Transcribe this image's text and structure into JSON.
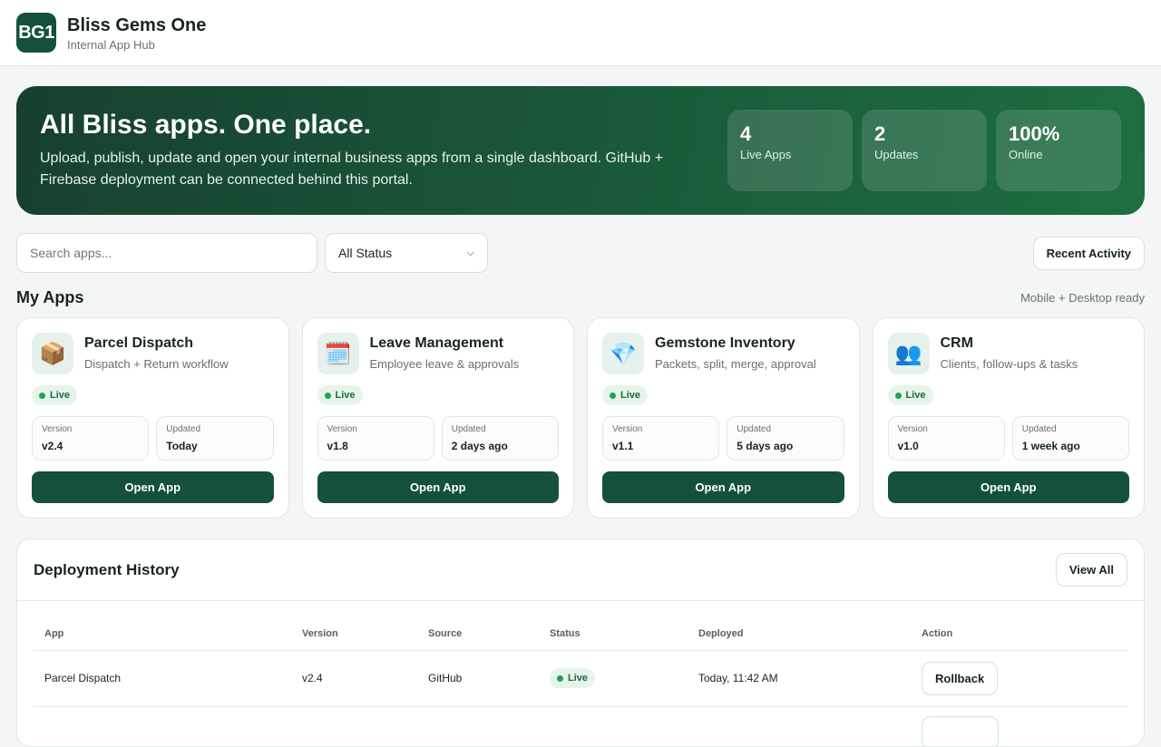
{
  "header": {
    "logo_text": "BG1",
    "title": "Bliss Gems One",
    "subtitle": "Internal App Hub"
  },
  "hero": {
    "title": "All Bliss apps. One place.",
    "description": "Upload, publish, update and open your internal business apps from a single dashboard. GitHub + Firebase deployment can be connected behind this portal.",
    "stats": [
      {
        "value": "4",
        "label": "Live Apps"
      },
      {
        "value": "2",
        "label": "Updates"
      },
      {
        "value": "100%",
        "label": "Online"
      }
    ]
  },
  "toolbar": {
    "search_placeholder": "Search apps...",
    "status_filter": "All Status",
    "recent_activity_label": "Recent Activity"
  },
  "apps_section": {
    "title": "My Apps",
    "note": "Mobile + Desktop ready"
  },
  "apps": [
    {
      "icon": "📦",
      "icon_name": "package-icon",
      "name": "Parcel Dispatch",
      "description": "Dispatch + Return workflow",
      "status": "Live",
      "version_label": "Version",
      "version": "v2.4",
      "updated_label": "Updated",
      "updated": "Today",
      "button": "Open App"
    },
    {
      "icon": "🗓️",
      "icon_name": "calendar-icon",
      "name": "Leave Management",
      "description": "Employee leave & approvals",
      "status": "Live",
      "version_label": "Version",
      "version": "v1.8",
      "updated_label": "Updated",
      "updated": "2 days ago",
      "button": "Open App"
    },
    {
      "icon": "💎",
      "icon_name": "gem-icon",
      "name": "Gemstone Inventory",
      "description": "Packets, split, merge, approval",
      "status": "Live",
      "version_label": "Version",
      "version": "v1.1",
      "updated_label": "Updated",
      "updated": "5 days ago",
      "button": "Open App"
    },
    {
      "icon": "👥",
      "icon_name": "people-icon",
      "name": "CRM",
      "description": "Clients, follow-ups & tasks",
      "status": "Live",
      "version_label": "Version",
      "version": "v1.0",
      "updated_label": "Updated",
      "updated": "1 week ago",
      "button": "Open App"
    }
  ],
  "deployments": {
    "title": "Deployment History",
    "view_all_label": "View All",
    "columns": [
      "App",
      "Version",
      "Source",
      "Status",
      "Deployed",
      "Action"
    ],
    "rows": [
      {
        "app": "Parcel Dispatch",
        "version": "v2.4",
        "source": "GitHub",
        "status": "Live",
        "deployed": "Today, 11:42 AM",
        "action": "Rollback"
      }
    ]
  },
  "colors": {
    "brand": "#15513a",
    "live_green": "#22a153",
    "background": "#f3f6f4"
  }
}
